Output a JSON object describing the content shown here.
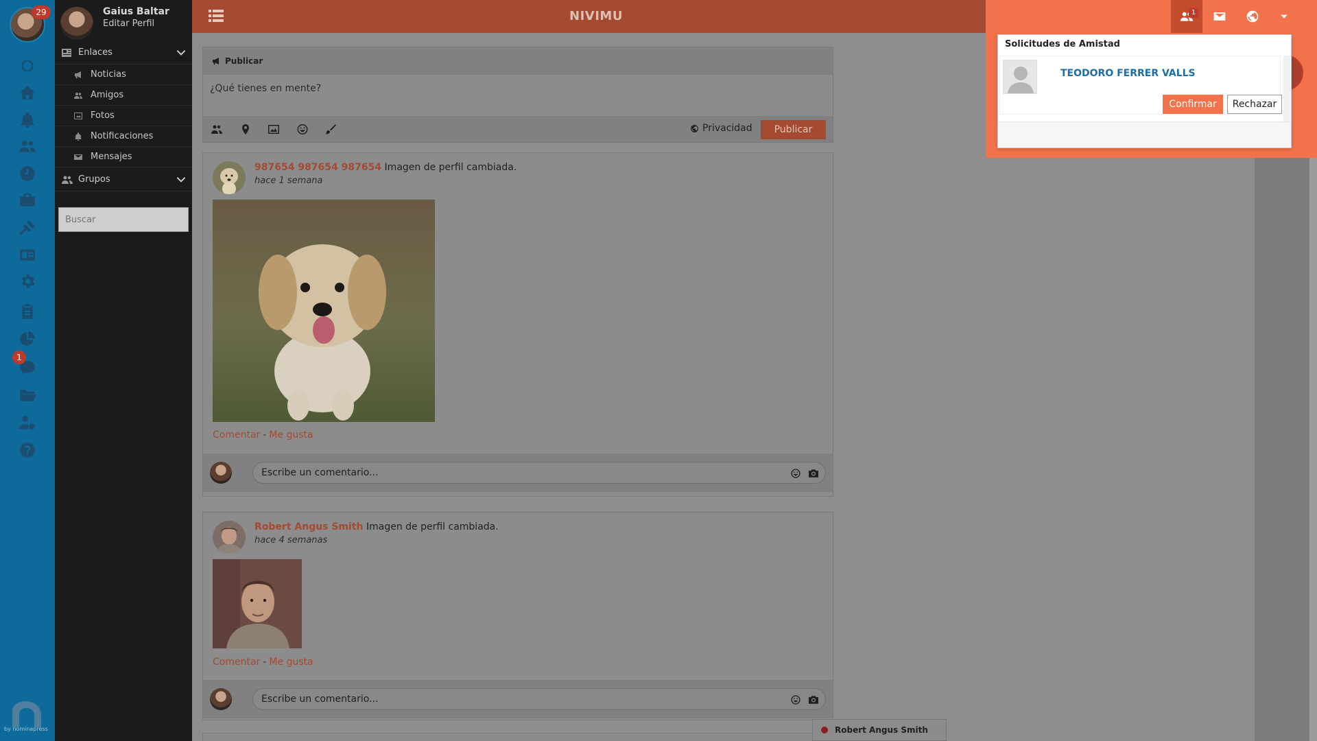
{
  "rail": {
    "notification_count": "29",
    "chat_badge": "1",
    "brand_text": "by nominapress",
    "icons": [
      "circle-icon",
      "home-icon",
      "bell-icon",
      "users-icon",
      "clock-icon",
      "briefcase-icon",
      "gavel-icon",
      "id-card-icon",
      "gear-icon",
      "clipboard-icon",
      "pie-chart-icon",
      "chat-icon",
      "folder-icon",
      "user-money-icon",
      "help-icon"
    ]
  },
  "user": {
    "name": "Gaius Baltar",
    "edit_label": "Editar Perfil"
  },
  "sidenav": {
    "links_label": "Enlaces",
    "items": [
      {
        "label": "Noticias",
        "icon": "bullhorn-icon"
      },
      {
        "label": "Amigos",
        "icon": "users-icon"
      },
      {
        "label": "Fotos",
        "icon": "image-icon"
      },
      {
        "label": "Notificaciones",
        "icon": "bell-icon"
      },
      {
        "label": "Mensajes",
        "icon": "envelope-icon"
      }
    ],
    "groups_label": "Grupos",
    "search_placeholder": "Buscar"
  },
  "topbar": {
    "title": "NIVIMU",
    "friend_request_count": "1"
  },
  "friend_requests": {
    "title": "Solicitudes de Amistad",
    "items": [
      {
        "name": "TEODORO FERRER VALLS",
        "confirm_label": "Confirmar",
        "reject_label": "Rechazar"
      }
    ]
  },
  "composer": {
    "header": "Publicar",
    "placeholder": "¿Qué tienes en mente?",
    "privacy_label": "Privacidad",
    "publish_label": "Publicar"
  },
  "posts": [
    {
      "author": "987654 987654 987654",
      "action": "Imagen de perfil cambiada.",
      "time": "hace 1 semana",
      "comment_label": "Comentar",
      "like_label": "Me gusta",
      "comment_placeholder": "Escribe un comentario..."
    },
    {
      "author": "Robert Angus Smith",
      "action": "Imagen de perfil cambiada.",
      "time": "hace 4 semanas",
      "comment_label": "Comentar",
      "like_label": "Me gusta",
      "comment_placeholder": "Escribe un comentario..."
    }
  ],
  "chat": {
    "contact": "Robert Angus Smith",
    "status_color": "#8e1f1f"
  }
}
